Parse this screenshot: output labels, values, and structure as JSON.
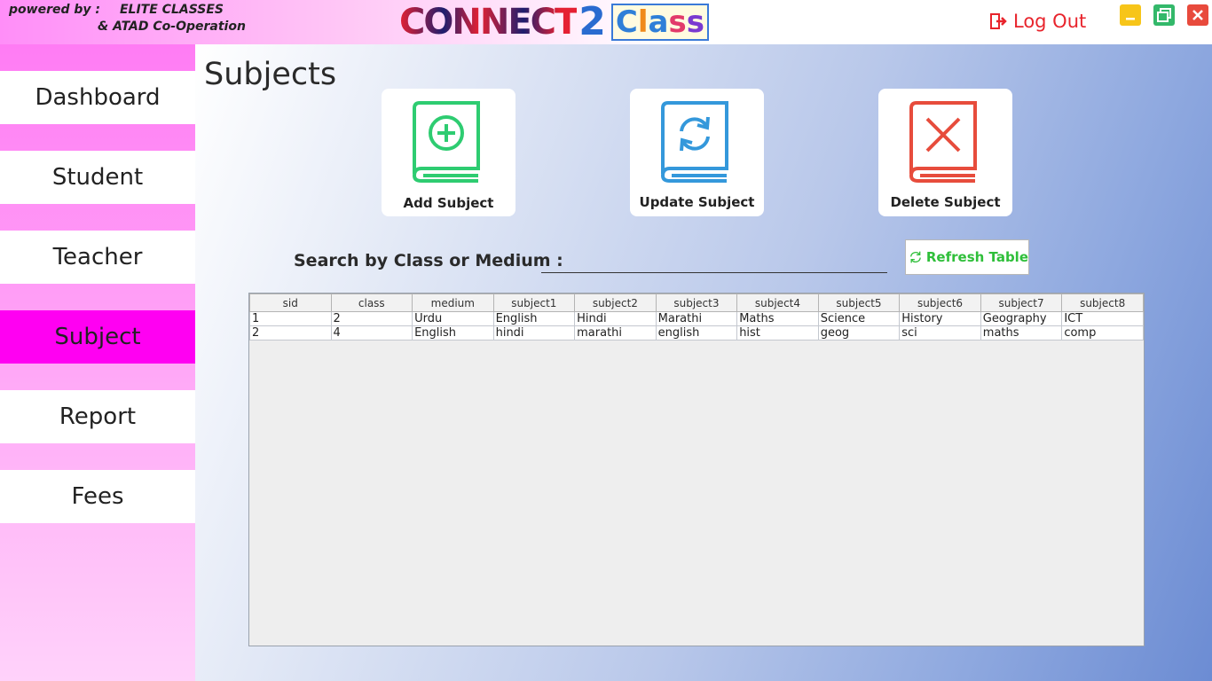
{
  "header": {
    "powered_by_label": "powered by :",
    "powered_by_org": "ELITE CLASSES",
    "cooperation": "& ATAD Co-Operation",
    "logo_part1": "CONNECT",
    "logo_part2": "2",
    "logo_part3": "Class",
    "logout_label": "Log Out",
    "logout_icon": "logout-door-icon",
    "window_controls": [
      "minimize-icon",
      "maximize-icon",
      "close-icon"
    ]
  },
  "sidebar": {
    "items": [
      {
        "label": "Dashboard",
        "active": false
      },
      {
        "label": "Student",
        "active": false
      },
      {
        "label": "Teacher",
        "active": false
      },
      {
        "label": "Subject",
        "active": true
      },
      {
        "label": "Report",
        "active": false
      },
      {
        "label": "Fees",
        "active": false
      }
    ]
  },
  "main": {
    "title": "Subjects",
    "actions": {
      "add": {
        "label": "Add Subject",
        "icon": "book-add-icon",
        "color": "#2ecc71"
      },
      "update": {
        "label": "Update Subject",
        "icon": "book-refresh-icon",
        "color": "#3498db"
      },
      "delete": {
        "label": "Delete Subject",
        "icon": "book-delete-icon",
        "color": "#e74c3c"
      }
    },
    "search": {
      "label": "Search by Class or Medium :",
      "value": "",
      "placeholder": ""
    },
    "refresh_label": "Refresh Table",
    "table": {
      "columns": [
        "sid",
        "class",
        "medium",
        "subject1",
        "subject2",
        "subject3",
        "subject4",
        "subject5",
        "subject6",
        "subject7",
        "subject8"
      ],
      "rows": [
        [
          "1",
          "2",
          "Urdu",
          "English",
          "Hindi",
          "Marathi",
          "Maths",
          "Science",
          "History",
          "Geography",
          "ICT"
        ],
        [
          "2",
          "4",
          "English",
          "hindi",
          "marathi",
          "english",
          "hist",
          "geog",
          "sci",
          "maths",
          "comp"
        ]
      ]
    }
  },
  "colors": {
    "sidebar_active": "#ff00f2",
    "logout_red": "#e8242c",
    "refresh_green": "#2fbf3a"
  }
}
